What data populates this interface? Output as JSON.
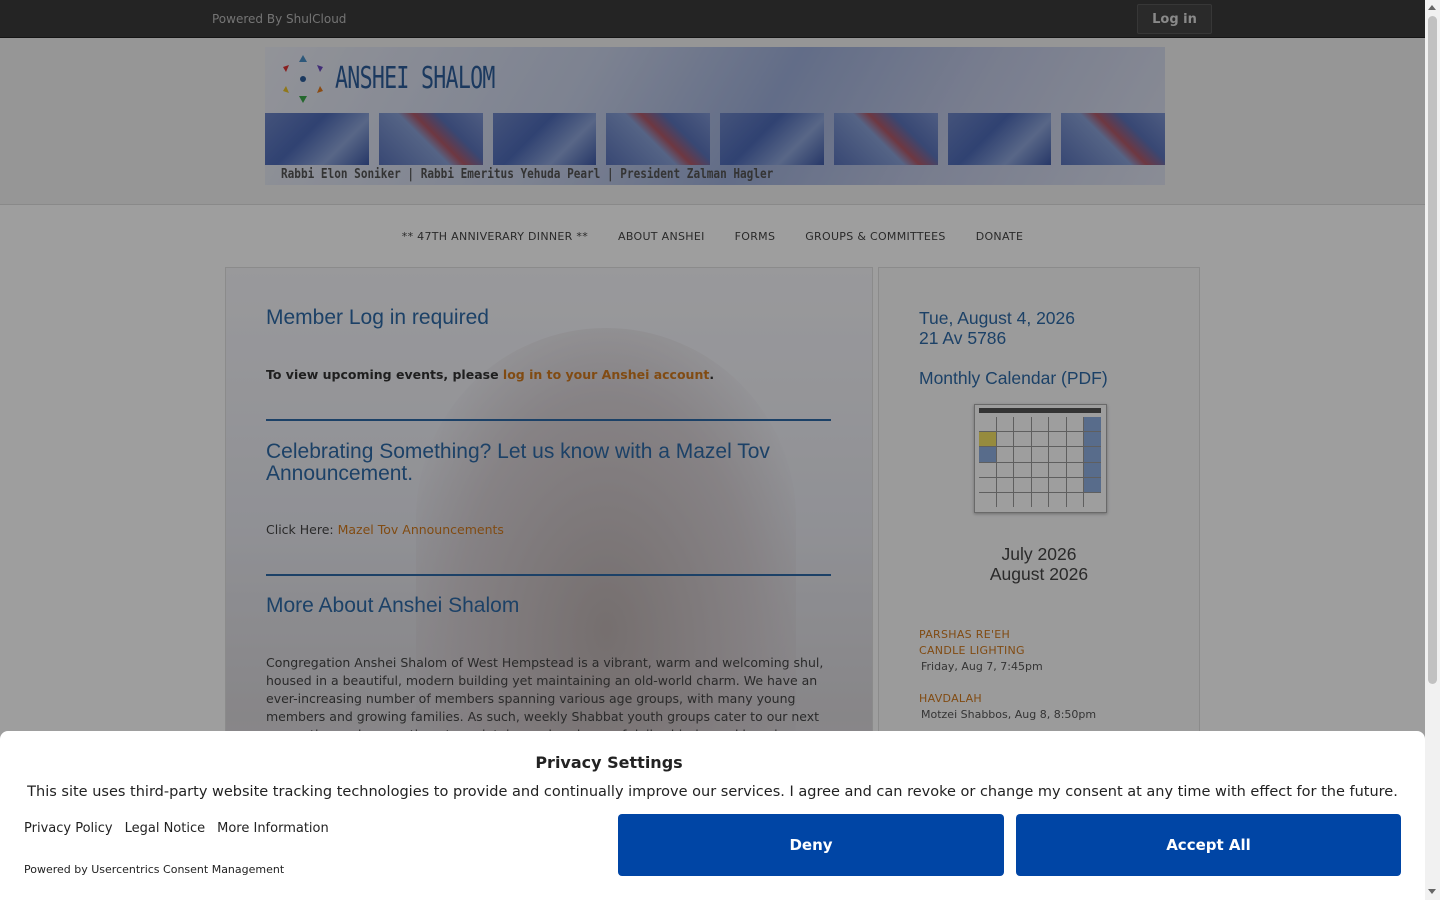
{
  "topbar": {
    "powered": "Powered By ShulCloud",
    "login": "Log in"
  },
  "header": {
    "logo_text": "ANSHEI SHALOM",
    "rabbis": "Rabbi Elon Soniker  |  Rabbi Emeritus Yehuda Pearl  |  President Zalman Hagler"
  },
  "nav": {
    "items": [
      "** 47TH ANNIVERARY DINNER **",
      "ABOUT ANSHEI",
      "FORMS",
      "GROUPS & COMMITTEES",
      "DONATE"
    ]
  },
  "main": {
    "login_title": "Member Log in required",
    "login_text_pre": "To view upcoming events, please ",
    "login_link": "log in to your Anshei account",
    "login_text_post": ".",
    "mazel_title": "Celebrating Something? Let us know with a Mazel Tov Announcement.",
    "mazel_prefix": "Click Here: ",
    "mazel_link": "Mazel Tov Announcements",
    "about_title": "More About Anshei Shalom",
    "about_text": "Congregation Anshei Shalom of West Hempstead is a vibrant, warm and welcoming shul, housed in a beautiful, modern building yet maintaining an old-world charm. We have an ever-increasing number of members spanning various age groups, with many young members and growing families. As such, weekly Shabbat youth groups cater to our next generation and we continue to maintain an abundance of daily shiurim and learning opportunities."
  },
  "sidebar": {
    "date": "Tue, August 4, 2026",
    "hebrew_date": "21 Av 5786",
    "calendar_link": "Monthly Calendar (PDF)",
    "month1": "July 2026",
    "month2": "August 2026",
    "events": [
      {
        "title1": "PARSHAS RE'EH",
        "title2": "CANDLE LIGHTING",
        "time": "Friday, Aug 7, 7:45pm"
      },
      {
        "title1": "HAVDALAH",
        "title2": "",
        "time": "Motzei Shabbos, Aug 8, 8:50pm"
      }
    ]
  },
  "consent": {
    "title": "Privacy Settings",
    "text": "This site uses third-party website tracking technologies to provide and continually improve our services. I agree and can revoke or change my consent at any time with effect for the future.",
    "links": [
      "Privacy Policy",
      "Legal Notice",
      "More Information"
    ],
    "powered": "Powered by Usercentrics Consent Management",
    "deny": "Deny",
    "accept": "Accept All",
    "button_color": "#0045a5"
  }
}
